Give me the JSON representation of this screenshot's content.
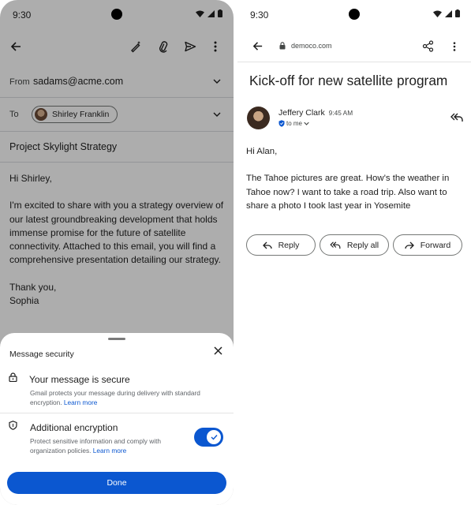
{
  "left": {
    "status_time": "9:30",
    "from_label": "From",
    "from_value": "sadams@acme.com",
    "to_label": "To",
    "to_chip": "Shirley Franklin",
    "subject": "Project Skylight Strategy",
    "body": [
      "Hi Shirley,",
      "I'm excited to share with you a strategy overview of our latest groundbreaking development that holds immense promise for the future of satellite connectivity. Attached to this email, you will find a comprehensive presentation detailing our strategy.",
      "Thank you,\nSophia"
    ],
    "sheet": {
      "title": "Message security",
      "secure_title": "Your message is secure",
      "secure_desc": "Gmail protects your message during delivery with standard encryption.",
      "learn_more": "Learn more",
      "encryption_title": "Additional encryption",
      "encryption_desc": "Protect sensitive information and comply with organization policies.",
      "encryption_enabled": true,
      "done_label": "Done"
    }
  },
  "right": {
    "status_time": "9:30",
    "url": "democo.com",
    "subject": "Kick-off for new satellite program",
    "sender": "Jeffery Clark",
    "time": "9:45 AM",
    "to_me": "to me",
    "body": [
      "Hi Alan,",
      "The Tahoe pictures are great. How’s the weather in Tahoe now? I want to take a road trip. Also want to share a photo I took last year in Yosemite"
    ],
    "actions": {
      "reply": "Reply",
      "reply_all": "Reply all",
      "forward": "Forward"
    }
  },
  "colors": {
    "accent": "#0b57d0",
    "scrim": "rgba(0,0,0,0.32)",
    "divider": "#dadce0"
  },
  "icons": [
    "back-arrow-icon",
    "magic-edit-icon",
    "attach-icon",
    "send-icon",
    "more-vert-icon",
    "chevron-down-icon",
    "lock-icon",
    "shield-icon",
    "close-icon",
    "check-icon",
    "share-icon",
    "reply-icon",
    "reply-all-icon",
    "forward-icon",
    "verified-shield-icon",
    "wifi-icon",
    "signal-icon",
    "battery-icon"
  ]
}
